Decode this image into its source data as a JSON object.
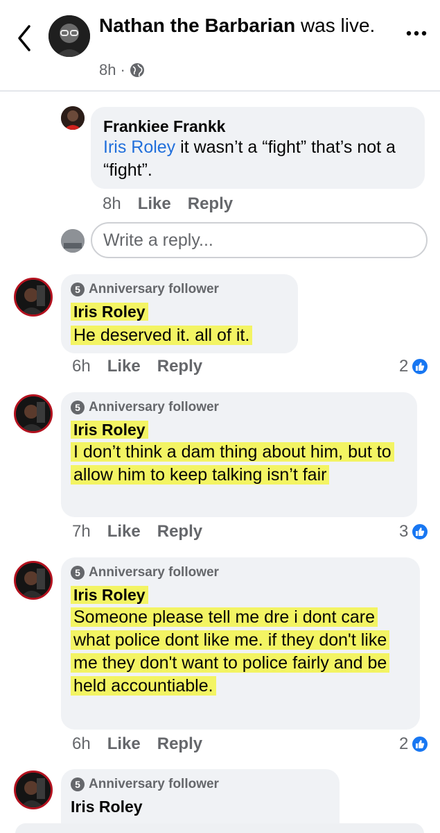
{
  "header": {
    "name": "Nathan the Barbarian",
    "action_text": "was live.",
    "time": "8h",
    "separator": "·"
  },
  "reply": {
    "author": "Frankiee Frankk",
    "mention": "Iris Roley",
    "text": "it wasn’t a “fight” that’s not a “fight”.",
    "time": "8h",
    "like_label": "Like",
    "reply_label": "Reply"
  },
  "write_reply": {
    "placeholder": "Write a reply..."
  },
  "comments": [
    {
      "badge_number": "5",
      "badge": "Anniversary follower",
      "author": "Iris Roley",
      "text": "He deserved it. all of it.",
      "time": "6h",
      "like_label": "Like",
      "reply_label": "Reply",
      "reaction_count": "2"
    },
    {
      "badge_number": "5",
      "badge": "Anniversary follower",
      "author": "Iris Roley",
      "text": "I don’t think a dam thing about him, but to allow him to keep talking isn’t fair",
      "time": "7h",
      "like_label": "Like",
      "reply_label": "Reply",
      "reaction_count": "3"
    },
    {
      "badge_number": "5",
      "badge": "Anniversary follower",
      "author": "Iris Roley",
      "text": "Someone please tell me dre i dont care what police dont like me. if they don't like me they don't want to police fairly and be held accountiable.",
      "time": "6h",
      "like_label": "Like",
      "reply_label": "Reply",
      "reaction_count": "2"
    },
    {
      "badge_number": "5",
      "badge": "Anniversary follower",
      "author": "Iris Roley"
    }
  ],
  "icons": {
    "back": "chevron-left-icon",
    "more": "more-horizontal-icon",
    "privacy": "globe-icon",
    "reaction": "like-icon",
    "badge": "anniversary-badge-icon"
  },
  "colors": {
    "mention": "#216fdb",
    "highlight": "#f3f463",
    "like_blue": "#1877f2",
    "avatar_ring": "#b3121f",
    "bubble": "#f0f2f5",
    "muted": "#65676b"
  }
}
